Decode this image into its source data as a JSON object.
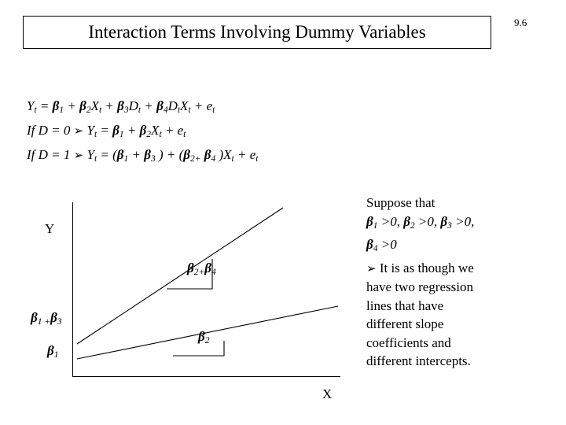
{
  "slide": {
    "title": "Interaction Terms Involving Dummy Variables",
    "number": "9.6"
  },
  "equations": {
    "line1": {
      "lhs": "Y",
      "lhs_sub": "t",
      "text": "= β1 + β2Xt + β3Dt + β4DtXt + et"
    },
    "line2": "If D = 0 → Yt = β1 + β2Xt + et",
    "line3": "If D = 1 → Yt = (β1 + β3 ) + (β2+ β4 )Xt + et"
  },
  "graph": {
    "y_axis_label": "Y",
    "x_axis_label": "X",
    "slope_label_upper": "β2+β4",
    "slope_label_lower": "β2",
    "intercept_label_upper": "β1 + β3",
    "intercept_label_lower": "β1"
  },
  "side_note": {
    "line1": "Suppose that",
    "line2": "β1 >0,  β2 >0, β3 >0,",
    "line3": "β4 >0",
    "line4": "→ It is as though we",
    "line5": "have two regression",
    "line6": "lines that have",
    "line7": "different slope",
    "line8": "coefficients and",
    "line9": "different intercepts."
  }
}
